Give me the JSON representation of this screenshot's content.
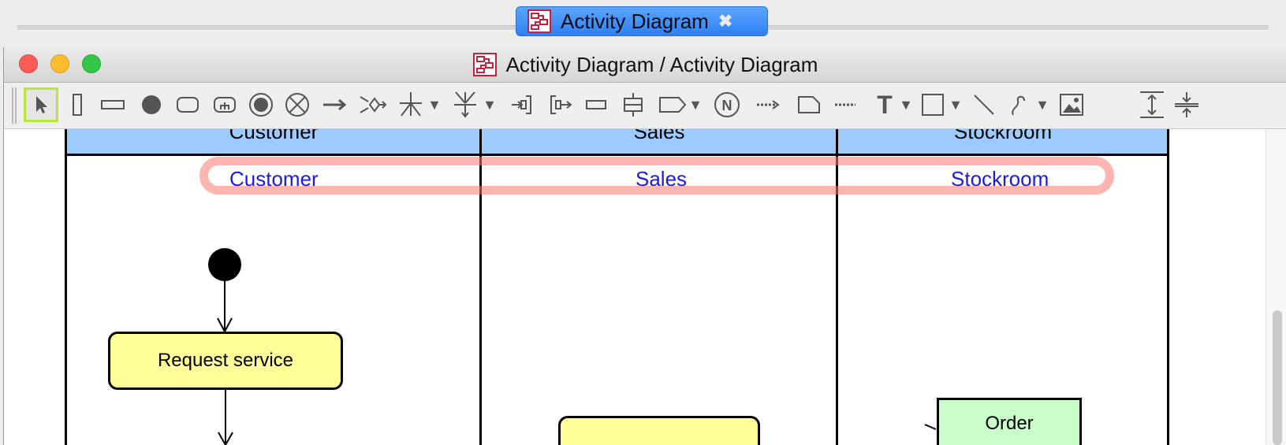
{
  "document_tab": {
    "label": "Activity Diagram",
    "close": "✖"
  },
  "window": {
    "title": "Activity Diagram / Activity Diagram"
  },
  "toolbar": {
    "tools": [
      {
        "name": "select-tool-icon"
      },
      {
        "name": "vertical-partition-icon"
      },
      {
        "name": "horizontal-partition-icon"
      },
      {
        "name": "initial-node-icon"
      },
      {
        "name": "action-icon"
      },
      {
        "name": "call-behavior-action-icon"
      },
      {
        "name": "final-node-icon"
      },
      {
        "name": "flow-final-icon"
      },
      {
        "name": "control-flow-icon"
      },
      {
        "name": "decision-icon"
      },
      {
        "name": "fork-icon"
      },
      {
        "name": "join-icon"
      },
      {
        "name": "input-pin-icon"
      },
      {
        "name": "output-pin-icon"
      },
      {
        "name": "object-node-icon"
      },
      {
        "name": "expansion-node-icon"
      },
      {
        "name": "send-signal-icon"
      },
      {
        "name": "n-node-icon"
      },
      {
        "name": "object-flow-icon"
      },
      {
        "name": "note-icon"
      },
      {
        "name": "anchor-icon"
      },
      {
        "name": "text-icon"
      },
      {
        "name": "rectangle-icon"
      },
      {
        "name": "line-icon"
      },
      {
        "name": "freehand-icon"
      },
      {
        "name": "image-icon"
      },
      {
        "name": "expand-vertical-icon"
      },
      {
        "name": "shrink-vertical-icon"
      }
    ],
    "text_tool": "T"
  },
  "diagram": {
    "lanes": [
      {
        "header": "Customer",
        "name": "Customer"
      },
      {
        "header": "Sales",
        "name": "Sales"
      },
      {
        "header": "Stockroom",
        "name": "Stockroom"
      }
    ],
    "actions": [
      {
        "label": "Request service"
      },
      {
        "label": ""
      }
    ],
    "object_node": {
      "label": "Order"
    },
    "colors": {
      "lane_header": "#9ecbfd",
      "action_fill": "#ffff99",
      "object_fill": "#c9fdca",
      "lane_name": "#1a1ae8",
      "highlight": "#ff786e"
    }
  }
}
